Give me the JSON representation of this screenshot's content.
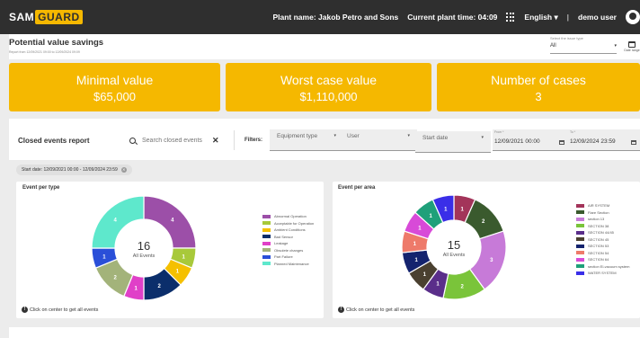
{
  "header": {
    "logo": {
      "sam": "SAM",
      "guard": "GUARD"
    },
    "plant_name": "Plant name: Jakob Petro and Sons",
    "plant_time": "Current plant time: 04:09",
    "language": "English",
    "language_caret": "▾",
    "separator": "|",
    "user": "demo user"
  },
  "page": {
    "title": "Potential value savings",
    "subtitle": "Report from 12/09/2021 09:00 to 12/09/2024 09:09",
    "issue_type_label": "Select the issue type",
    "issue_type_value": "All",
    "issue_type_caret": "▾",
    "date_range_label": "Date range"
  },
  "kpis": [
    {
      "label": "Minimal value",
      "value": "$65,000"
    },
    {
      "label": "Worst case value",
      "value": "$1,110,000"
    },
    {
      "label": "Number of cases",
      "value": "3"
    }
  ],
  "report": {
    "title": "Closed events report",
    "search_placeholder": "Search closed events",
    "clear": "✕",
    "filters_label": "Filters:",
    "filters": [
      {
        "label": "Equipment type",
        "caret": "▾"
      },
      {
        "label": "User",
        "caret": "▾"
      },
      {
        "label": "Start date",
        "caret": "▾"
      }
    ],
    "from": {
      "label": "From *",
      "value": "12/09/2021 00:00"
    },
    "to": {
      "label": "To *",
      "value": "12/09/2024 23:59"
    },
    "chip": "Start date: 12/09/2021 00:00 - 12/09/2024 23:59",
    "chip_close": "✕"
  },
  "charts": {
    "footnote_icon": "!",
    "footnote": "Click on center to get all events",
    "center_sub": "All Events"
  },
  "chart_data": [
    {
      "type": "pie",
      "title": "Event per type",
      "total": 16,
      "slices": [
        {
          "label": "Abnormal Operation",
          "value": 4,
          "color": "#9c4fa8"
        },
        {
          "label": "Acceptable for Operation",
          "value": 1,
          "color": "#a8c93a"
        },
        {
          "label": "Ambient Conditions",
          "value": 1,
          "color": "#f5c000"
        },
        {
          "label": "Bad Sensor",
          "value": 2,
          "color": "#0b2e6b"
        },
        {
          "label": "Leakage",
          "value": 1,
          "color": "#e040c8"
        },
        {
          "label": "Obsolete changes",
          "value": 2,
          "color": "#a3b37a"
        },
        {
          "label": "Part Failure",
          "value": 1,
          "color": "#2a4fd8"
        },
        {
          "label": "Planned Maintenance",
          "value": 4,
          "color": "#5ee8cc"
        }
      ]
    },
    {
      "type": "pie",
      "title": "Event per area",
      "total": 15,
      "slices": [
        {
          "label": "AIR SYSTEM",
          "value": 1,
          "color": "#a3345a"
        },
        {
          "label": "Flare Section",
          "value": 2,
          "color": "#3a5a2e"
        },
        {
          "label": "section 13",
          "value": 3,
          "color": "#c77ad8"
        },
        {
          "label": "SECTION 38",
          "value": 2,
          "color": "#7ac43a"
        },
        {
          "label": "SECTION 44/45",
          "value": 1,
          "color": "#5a2e8a"
        },
        {
          "label": "SECTION 45",
          "value": 1,
          "color": "#4a4030"
        },
        {
          "label": "SECTION 53",
          "value": 1,
          "color": "#14236e"
        },
        {
          "label": "SECTION 54",
          "value": 1,
          "color": "#ee7a6a"
        },
        {
          "label": "SECTION 64",
          "value": 1,
          "color": "#d84ad8"
        },
        {
          "label": "section El-vacuum system",
          "value": 1,
          "color": "#1fa07a"
        },
        {
          "label": "WATER SYSTEM",
          "value": 1,
          "color": "#3a2ee8"
        }
      ]
    }
  ]
}
